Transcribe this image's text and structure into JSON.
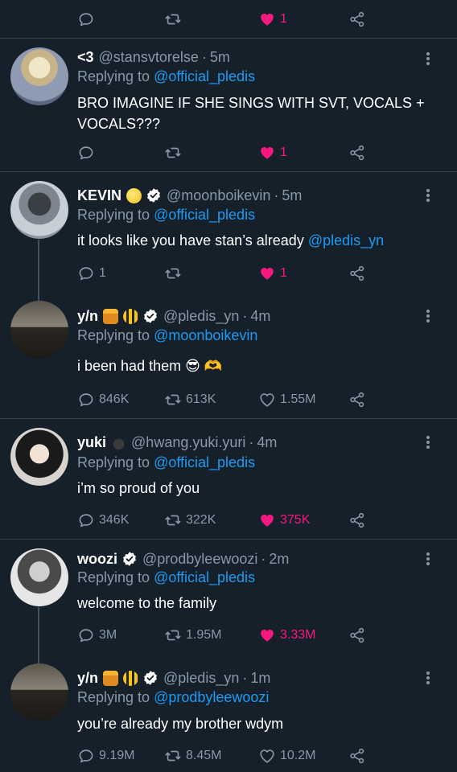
{
  "top_actions": {
    "reply": "",
    "retweet": "",
    "like": "1"
  },
  "tweets": [
    {
      "name": "<3",
      "handle": "@stansvtorelse",
      "time": "5m",
      "replying_label": "Replying to ",
      "replying_to": "@official_pledis",
      "text": "BRO IMAGINE IF SHE SINGS WITH SVT, VOCALS + VOCALS???",
      "mention": "",
      "reply_count": "",
      "retweet_count": "",
      "like_count": "1",
      "liked": true
    },
    {
      "name": "KEVIN",
      "handle": "@moonboikevin",
      "time": "5m",
      "replying_label": "Replying to ",
      "replying_to": "@official_pledis",
      "text": "it looks like you have stan’s already ",
      "mention": "@pledis_yn",
      "reply_count": "1",
      "retweet_count": "",
      "like_count": "1",
      "liked": true
    },
    {
      "name": "y/n",
      "handle": "@pledis_yn",
      "time": "4m",
      "replying_label": "Replying to ",
      "replying_to": "@moonboikevin",
      "text": "i been had them 😎 🫶",
      "mention": "",
      "reply_count": "846K",
      "retweet_count": "613K",
      "like_count": "1.55M",
      "liked": false
    },
    {
      "name": "yuki",
      "handle": "@hwang.yuki.yuri",
      "time": "4m",
      "replying_label": "Replying to ",
      "replying_to": "@official_pledis",
      "text": "i’m so proud of you",
      "mention": "",
      "reply_count": "346K",
      "retweet_count": "322K",
      "like_count": "375K",
      "liked": true
    },
    {
      "name": "woozi",
      "handle": "@prodbyleewoozi",
      "time": "2m",
      "replying_label": "Replying to ",
      "replying_to": "@official_pledis",
      "text": "welcome to the family",
      "mention": "",
      "reply_count": "3M",
      "retweet_count": "1.95M",
      "like_count": "3.33M",
      "liked": true
    },
    {
      "name": "y/n",
      "handle": "@pledis_yn",
      "time": "1m",
      "replying_label": "Replying to ",
      "replying_to": "@prodbyleewoozi",
      "text": "you’re already my brother wdym",
      "mention": "",
      "reply_count": "9.19M",
      "retweet_count": "8.45M",
      "like_count": "10.2M",
      "liked": false
    }
  ],
  "separator_dot": "·",
  "colors": {
    "background": "#15202b",
    "muted": "#8899a6",
    "link": "#1d9bf0",
    "like": "#f91880",
    "divider": "#38444d"
  },
  "icons": [
    "reply-icon",
    "retweet-icon",
    "heart-icon",
    "share-icon",
    "more-icon",
    "verified-icon",
    "moon-emoji",
    "honey-pot-emoji",
    "bee-emoji",
    "cat-emoji"
  ]
}
